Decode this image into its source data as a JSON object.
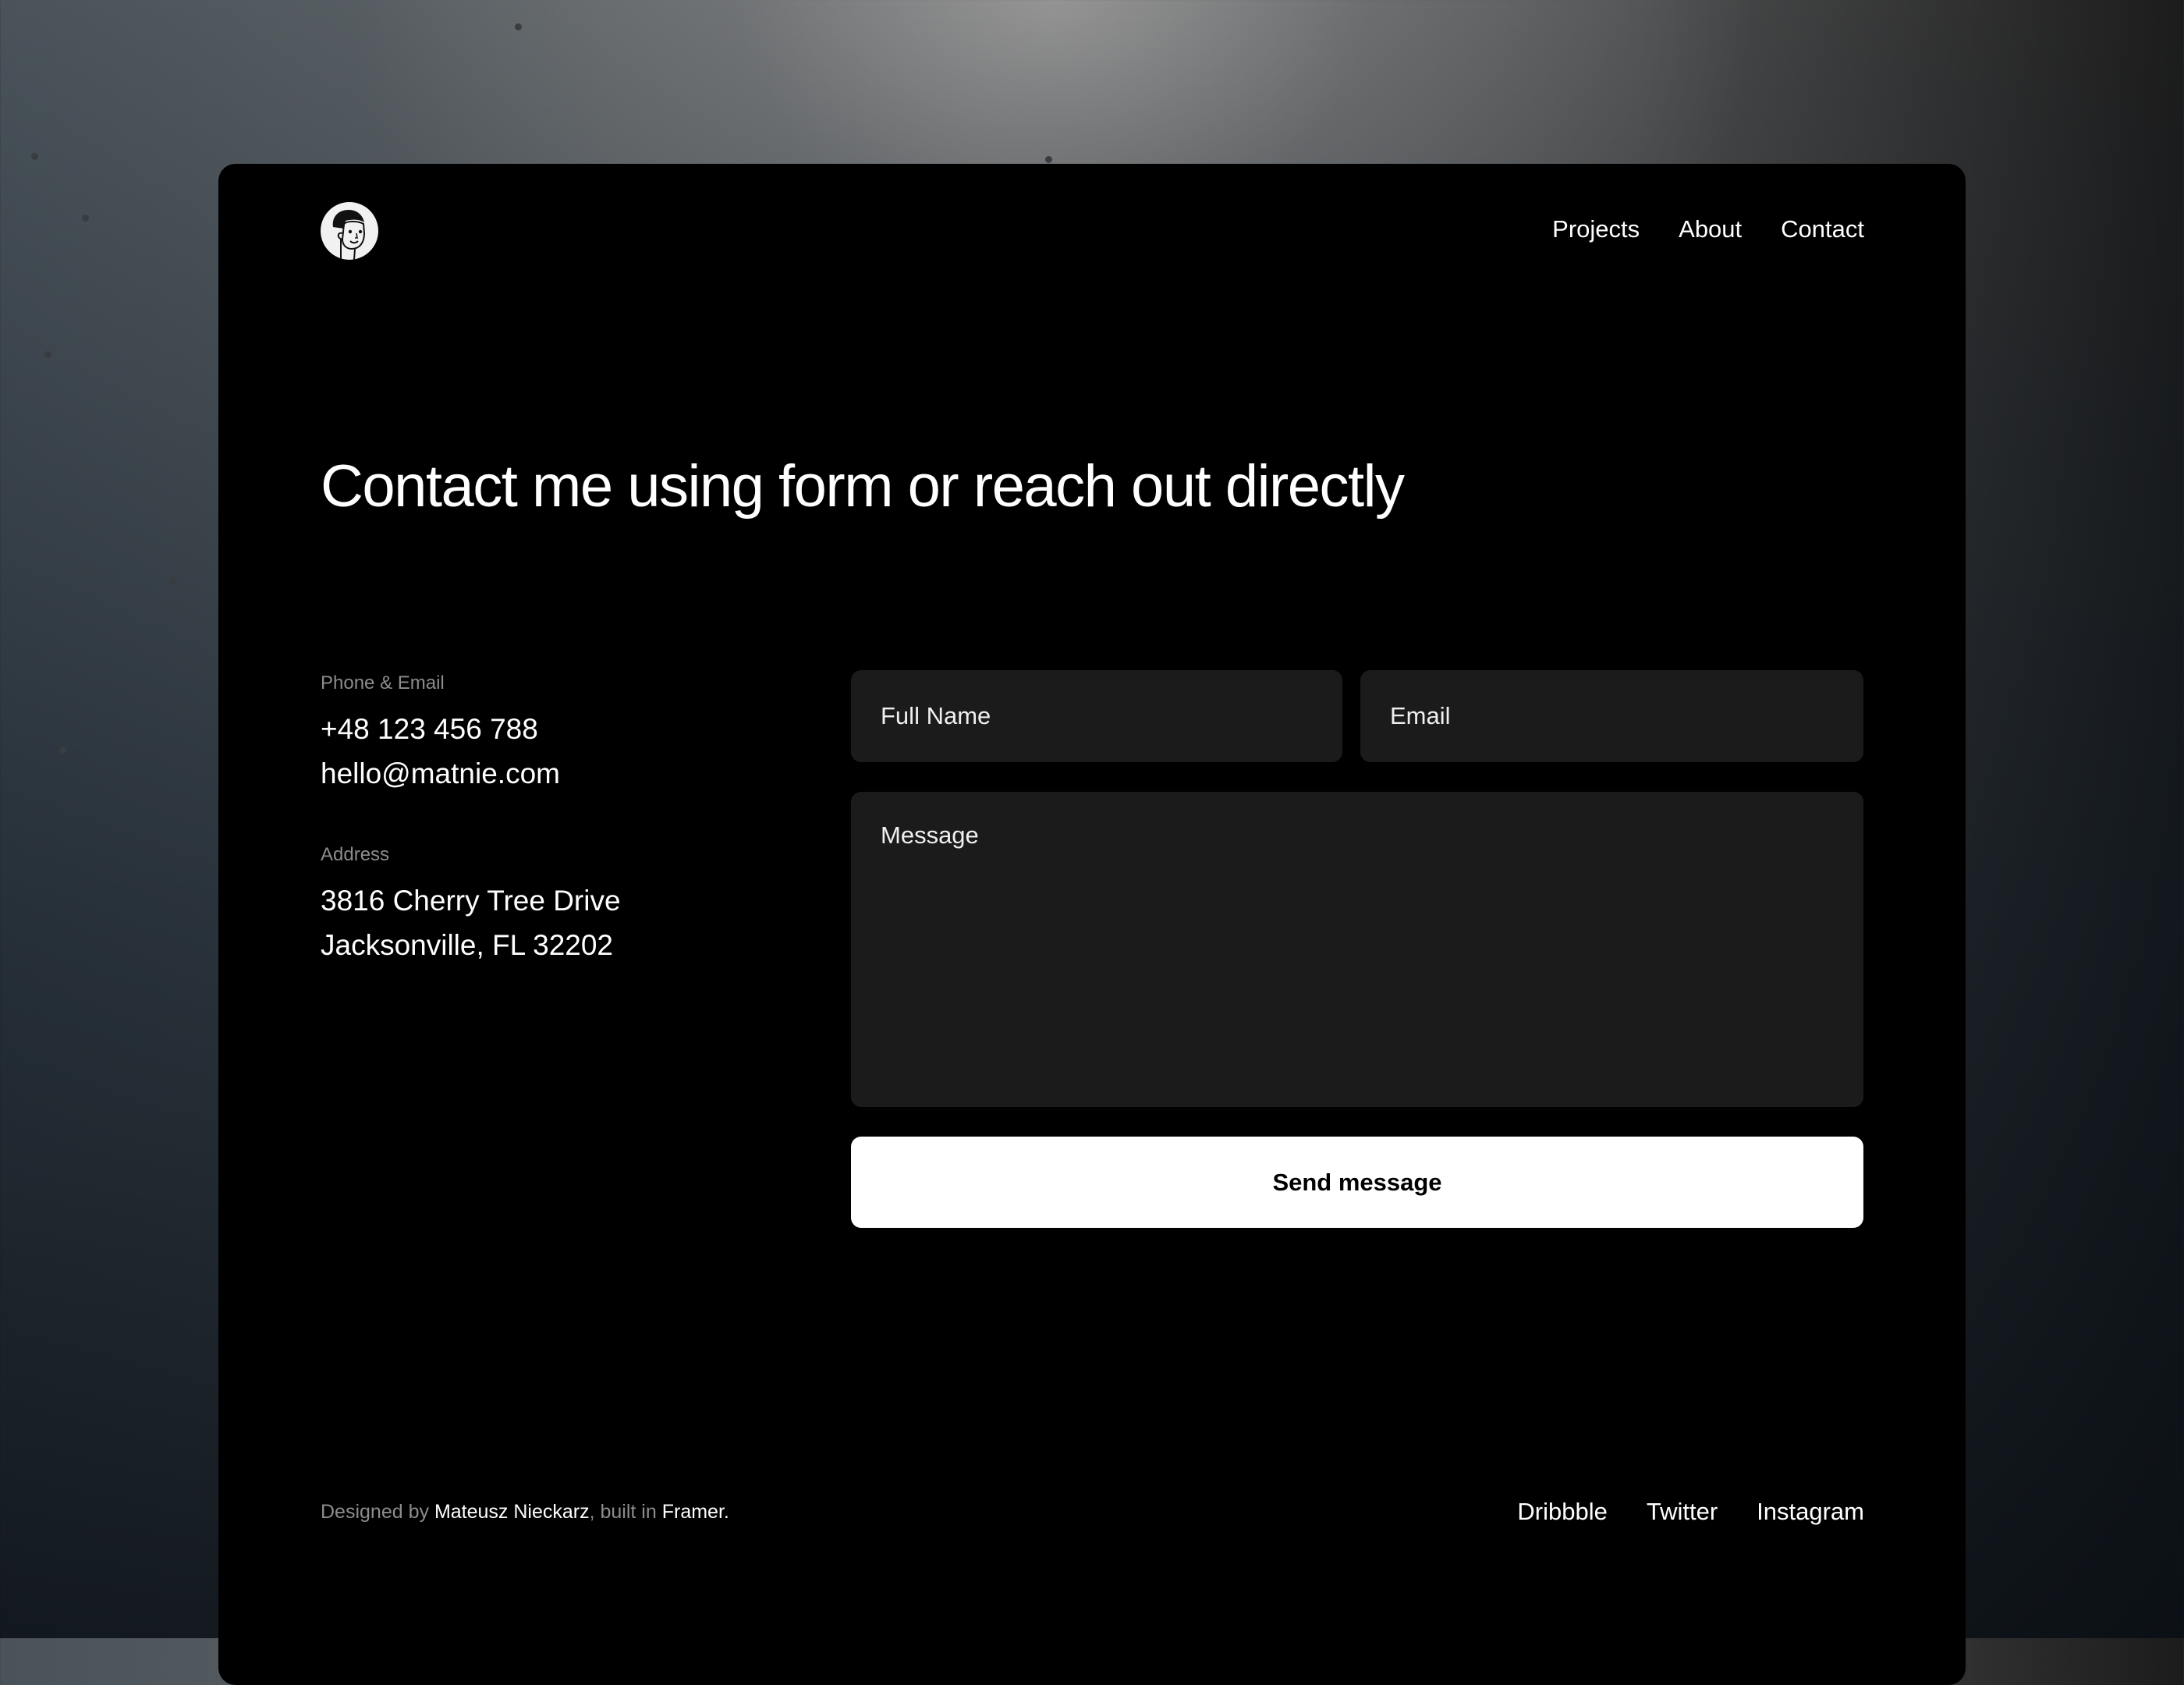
{
  "header": {
    "logo_alt": "Avatar illustration of a smiling man",
    "nav": [
      {
        "label": "Projects"
      },
      {
        "label": "About"
      },
      {
        "label": "Contact"
      }
    ]
  },
  "main": {
    "title": "Contact me using form or reach out directly",
    "contact": {
      "phone_email_label": "Phone & Email",
      "phone": "+48 123 456 788",
      "email": "hello@matnie.com",
      "address_label": "Address",
      "address_line1": "3816 Cherry Tree Drive",
      "address_line2": "Jacksonville, FL 32202"
    },
    "form": {
      "full_name": {
        "value": "",
        "placeholder": "Full Name"
      },
      "email": {
        "value": "",
        "placeholder": "Email"
      },
      "message": {
        "value": "",
        "placeholder": "Message"
      },
      "submit_label": "Send message"
    }
  },
  "footer": {
    "credit_prefix": "Designed by ",
    "designer": "Mateusz Nieckarz",
    "credit_middle": ", built in ",
    "tool": "Framer.",
    "social": [
      {
        "label": "Dribbble"
      },
      {
        "label": "Twitter"
      },
      {
        "label": "Instagram"
      }
    ]
  },
  "colors": {
    "card_background": "#000000",
    "input_background": "#1b1b1b",
    "button_background": "#ffffff",
    "muted_text": "#8c8c8c"
  }
}
